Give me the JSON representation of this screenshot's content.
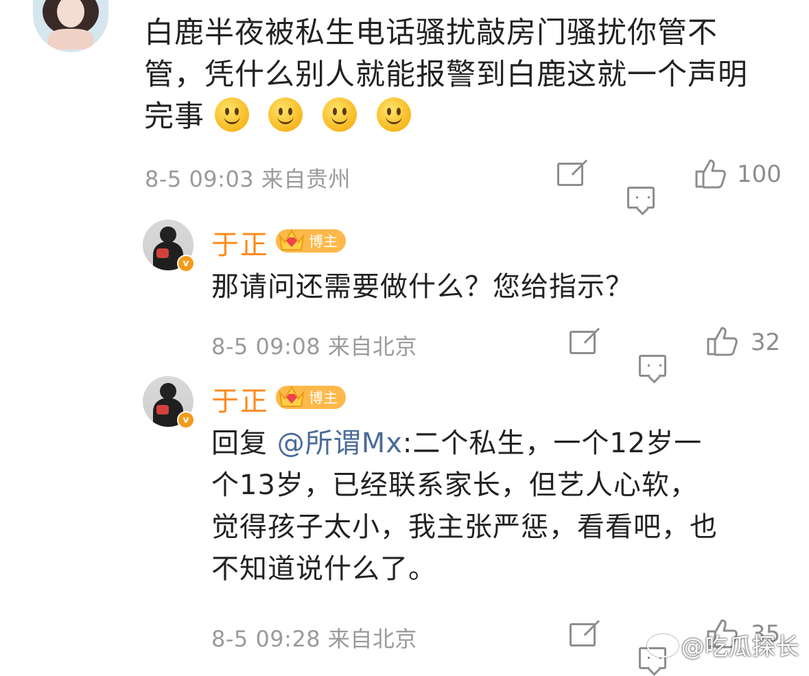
{
  "comment": {
    "text_line1": "白鹿半夜被私生电话骚扰敲房门骚扰你管不",
    "text_line2": "管，凭什么别人就能报警到白鹿这就一个声明",
    "text_line3": "完事",
    "emojis": [
      "smile-emoji",
      "smile-emoji",
      "smile-emoji",
      "smile-emoji"
    ],
    "meta": "8-5 09:03 来自贵州",
    "like_count": "100"
  },
  "replies": [
    {
      "username": "于正",
      "badge": "博主",
      "text_lines": [
        "那请问还需要做什么？您给指示？"
      ],
      "meta": "8-5 09:08 来自北京",
      "like_count": "32"
    },
    {
      "username": "于正",
      "badge": "博主",
      "reply_prefix": "回复 ",
      "mention": "@所谓Mx",
      "text_first": ":二个私生，一个12岁一",
      "text_lines": [
        "个13岁，已经联系家长，但艺人心软，",
        "觉得孩子太小，我主张严惩，看看吧，也",
        "不知道说什么了。"
      ],
      "meta": "8-5 09:28 来自北京",
      "like_count": "35"
    }
  ],
  "watermark": "@吃瓜探长",
  "colors": {
    "username": "#ff8a1e",
    "badge": "#ffb84a",
    "mention": "#496c98",
    "meta": "#9a9a9a",
    "icon": "#8d8d8d"
  },
  "icons": [
    "share-icon",
    "comment-icon",
    "like-icon",
    "verified-icon",
    "crown-icon",
    "weibo-icon"
  ]
}
